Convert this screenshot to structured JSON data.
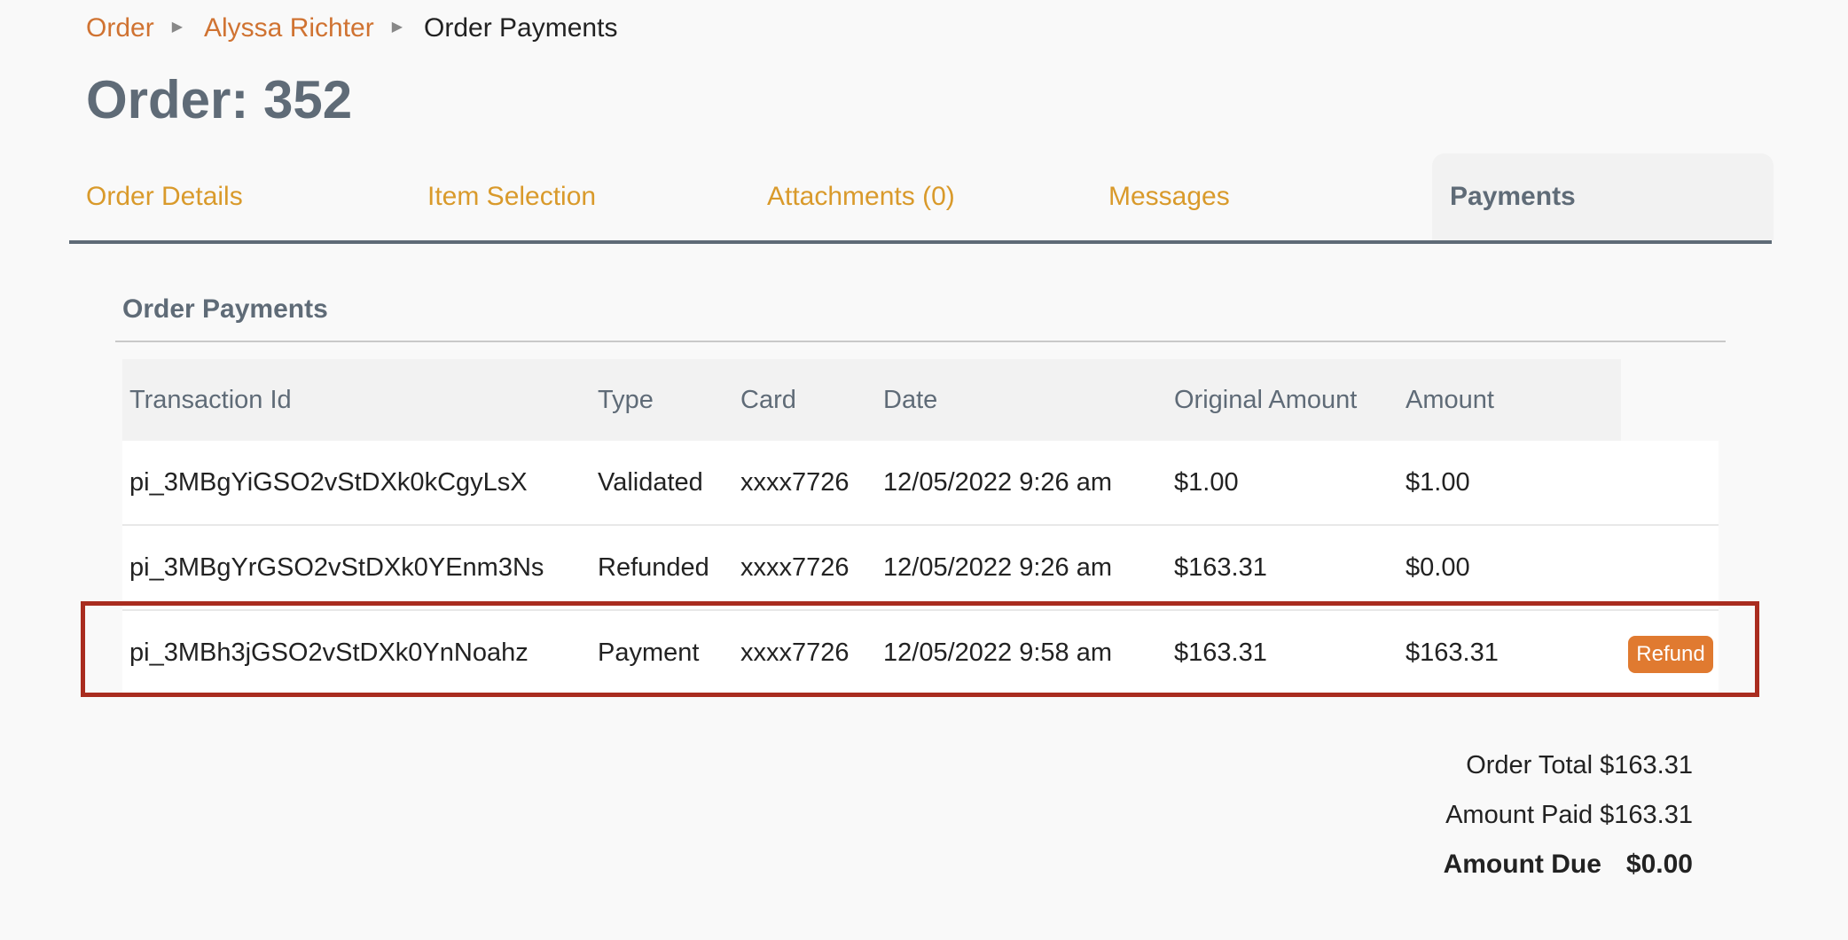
{
  "breadcrumb": {
    "items": [
      "Order",
      "Alyssa Richter"
    ],
    "current": "Order Payments",
    "separator": "▶"
  },
  "page": {
    "title": "Order: 352"
  },
  "tabs": [
    {
      "label": "Order Details",
      "active": false
    },
    {
      "label": "Item Selection",
      "active": false
    },
    {
      "label": "Attachments (0)",
      "active": false
    },
    {
      "label": "Messages",
      "active": false
    },
    {
      "label": "Payments",
      "active": true
    }
  ],
  "section": {
    "title": "Order Payments"
  },
  "table": {
    "headers": [
      "Transaction Id",
      "Type",
      "Card",
      "Date",
      "Original Amount",
      "Amount"
    ],
    "rows": [
      {
        "transaction_id": "pi_3MBgYiGSO2vStDXk0kCgyLsX",
        "type": "Validated",
        "card": "xxxx7726",
        "date": "12/05/2022 9:26 am",
        "original_amount": "$1.00",
        "amount": "$1.00"
      },
      {
        "transaction_id": "pi_3MBgYrGSO2vStDXk0YEnm3Ns",
        "type": "Refunded",
        "card": "xxxx7726",
        "date": "12/05/2022 9:26 am",
        "original_amount": "$163.31",
        "amount": "$0.00"
      },
      {
        "transaction_id": "pi_3MBh3jGSO2vStDXk0YnNoahz",
        "type": "Payment",
        "card": "xxxx7726",
        "date": "12/05/2022 9:58 am",
        "original_amount": "$163.31",
        "amount": "$163.31",
        "action_label": "Refund"
      }
    ]
  },
  "totals": {
    "order_total": "Order Total $163.31",
    "amount_paid": "Amount Paid $163.31",
    "amount_due_label": "Amount Due",
    "amount_due_value": "$0.00"
  },
  "colors": {
    "link": "#d07332",
    "tab": "#d99a2b",
    "heading": "#5f6b77",
    "refund_button": "#e07a30",
    "highlight": "#a92c1f"
  }
}
